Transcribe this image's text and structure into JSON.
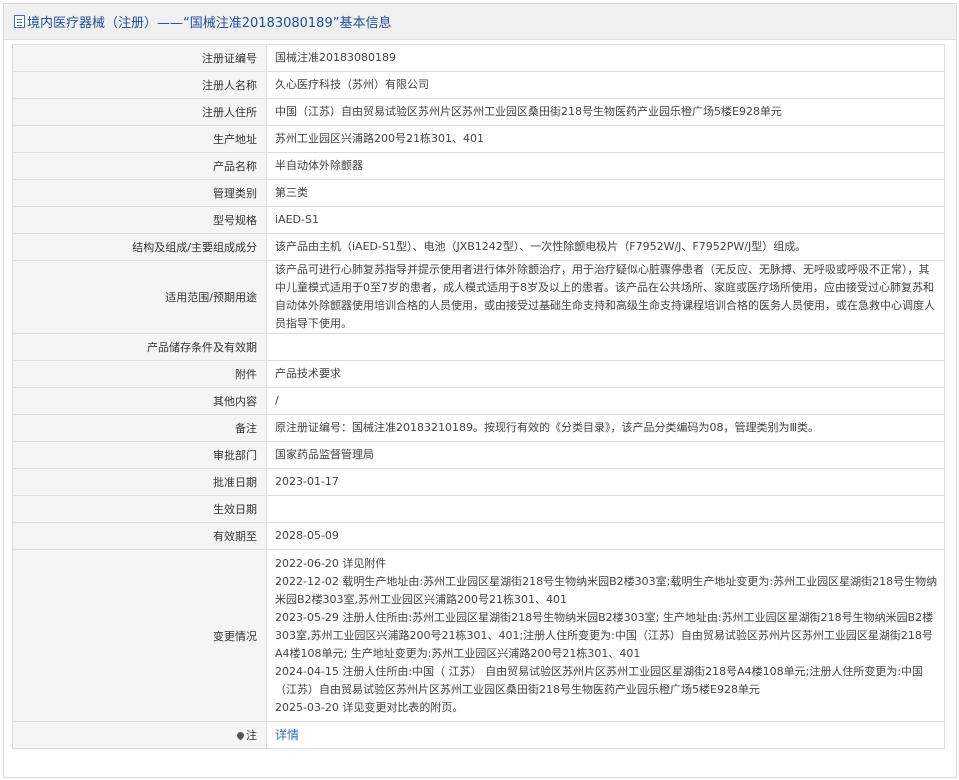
{
  "header": {
    "title": "境内医疗器械（注册）——“国械注准20183080189”基本信息"
  },
  "rows": [
    {
      "label": "注册证编号",
      "value": "国械注准20183080189"
    },
    {
      "label": "注册人名称",
      "value": "久心医疗科技（苏州）有限公司"
    },
    {
      "label": "注册人住所",
      "value": "中国（江苏）自由贸易试验区苏州片区苏州工业园区桑田街218号生物医药产业园乐橙广场5楼E928单元"
    },
    {
      "label": "生产地址",
      "value": "苏州工业园区兴浦路200号21栋301、401"
    },
    {
      "label": "产品名称",
      "value": "半自动体外除颤器"
    },
    {
      "label": "管理类别",
      "value": "第三类"
    },
    {
      "label": "型号规格",
      "value": "iAED-S1"
    },
    {
      "label": "结构及组成/主要组成成分",
      "value": "该产品由主机（iAED-S1型）、电池（JXB1242型）、一次性除颤电极片（F7952W/J、F7952PW/J型）组成。"
    },
    {
      "label": "适用范围/预期用途",
      "value": "该产品可进行心肺复苏指导并提示使用者进行体外除颤治疗，用于治疗疑似心脏骤停患者（无反应、无脉搏、无呼吸或呼吸不正常），其中儿童模式适用于0至7岁的患者，成人模式适用于8岁及以上的患者。该产品在公共场所、家庭或医疗场所使用，应由接受过心肺复苏和自动体外除颤器使用培训合格的人员使用，或由接受过基础生命支持和高级生命支持课程培训合格的医务人员使用，或在急救中心调度人员指导下使用。"
    },
    {
      "label": "产品储存条件及有效期",
      "value": ""
    },
    {
      "label": "附件",
      "value": "产品技术要求"
    },
    {
      "label": "其他内容",
      "value": "/"
    },
    {
      "label": "备注",
      "value": "原注册证编号：国械注准20183210189。按现行有效的《分类目录》，该产品分类编码为08，管理类别为Ⅲ类。"
    },
    {
      "label": "审批部门",
      "value": "国家药品监督管理局"
    },
    {
      "label": "批准日期",
      "value": "2023-01-17"
    },
    {
      "label": "生效日期",
      "value": ""
    },
    {
      "label": "有效期至",
      "value": "2028-05-09"
    }
  ],
  "changes": {
    "label": "变更情况",
    "lines": [
      "2022-06-20 详见附件",
      "2022-12-02 载明生产地址由:苏州工业园区星湖街218号生物纳米园B2楼303室;载明生产地址变更为:苏州工业园区星湖街218号生物纳米园B2楼303室,苏州工业园区兴浦路200号21栋301、401",
      "2023-05-29 注册人住所由:苏州工业园区星湖街218号生物纳米园B2楼303室; 生产地址由:苏州工业园区星湖街218号生物纳米园B2楼303室,苏州工业园区兴浦路200号21栋301、401;注册人住所变更为:中国（江苏）自由贸易试验区苏州片区苏州工业园区星湖街218号A4楼108单元; 生产地址变更为:苏州工业园区兴浦路200号21栋301、401",
      "2024-04-15 注册人住所由:中国（ 江苏） 自由贸易试验区苏州片区苏州工业园区星湖街218号A4楼108单元;注册人住所变更为:中国（江苏）自由贸易试验区苏州片区苏州工业园区桑田街218号生物医药产业园乐橙广场5楼E928单元",
      "2025-03-20 详见变更对比表的附页。"
    ]
  },
  "note": {
    "label": "注",
    "link_text": "详情",
    "icon": "pin-icon"
  }
}
